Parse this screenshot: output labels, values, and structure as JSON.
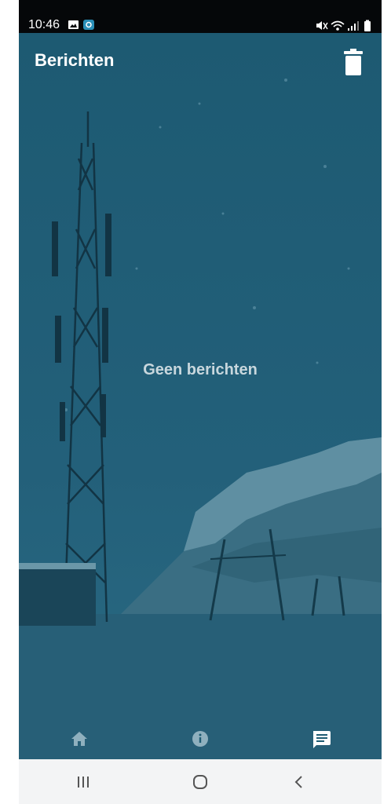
{
  "status_bar": {
    "time": "10:46",
    "left_icons": [
      "image-notification-icon",
      "app-notification-icon"
    ],
    "right_icons": [
      "mute-icon",
      "wifi-icon",
      "signal-icon",
      "battery-icon"
    ]
  },
  "header": {
    "title": "Berichten",
    "action_icon": "trash-icon"
  },
  "main": {
    "empty_message": "Geen berichten"
  },
  "tabs": [
    {
      "icon": "home-icon",
      "active": false
    },
    {
      "icon": "info-icon",
      "active": false
    },
    {
      "icon": "message-icon",
      "active": true
    }
  ],
  "system_nav": [
    "recents-icon",
    "home-circle-icon",
    "back-icon"
  ],
  "colors": {
    "background": "#1f5c73",
    "status_bar": "#050709",
    "text": "#ffffff",
    "muted_text": "#c8d7dd",
    "inactive_tab": "#8fb0be",
    "nav_bar": "#f3f4f5"
  }
}
